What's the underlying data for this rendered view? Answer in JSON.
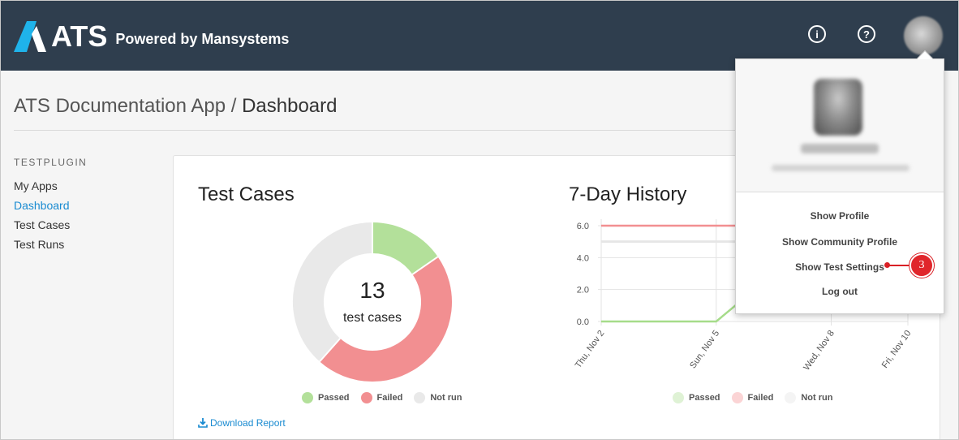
{
  "header": {
    "brand": "ATS",
    "tagline": "Powered by Mansystems",
    "icons": [
      "info-icon",
      "help-icon"
    ],
    "colors": {
      "bar": "#2f3e4e",
      "logo": "#1fb3ea"
    }
  },
  "breadcrumb": {
    "app": "ATS Documentation App",
    "separator": "/",
    "current": "Dashboard"
  },
  "sidebar": {
    "heading": "TESTPLUGIN",
    "items": [
      {
        "label": "My Apps",
        "active": false
      },
      {
        "label": "Dashboard",
        "active": true
      },
      {
        "label": "Test Cases",
        "active": false
      },
      {
        "label": "Test Runs",
        "active": false
      }
    ]
  },
  "test_cases": {
    "title": "Test Cases",
    "count": "13",
    "count_label": "test cases",
    "download_label": "Download Report"
  },
  "history": {
    "title": "7-Day History"
  },
  "legend": {
    "passed": "Passed",
    "failed": "Failed",
    "not_run": "Not run"
  },
  "dropdown": {
    "items": [
      "Show Profile",
      "Show Community Profile",
      "Show Test Settings",
      "Log out"
    ],
    "callout": "3"
  },
  "chart_data": [
    {
      "type": "pie",
      "title": "Test Cases",
      "categories": [
        "Passed",
        "Failed",
        "Not run"
      ],
      "values": [
        2,
        6,
        5
      ],
      "colors": [
        "#b3e09a",
        "#f28f91",
        "#e9e9e9"
      ]
    },
    {
      "type": "line",
      "title": "7-Day History",
      "x": [
        "Thu, Nov 2",
        "Sun, Nov 5",
        "Wed, Nov 8",
        "Fri, Nov 10"
      ],
      "ylim": [
        0,
        6
      ],
      "yticks": [
        "0.0",
        "2.0",
        "4.0",
        "6.0"
      ],
      "series": [
        {
          "name": "Passed",
          "color": "#a6dc8a",
          "points": [
            [
              "Thu, Nov 2",
              0
            ],
            [
              "Sun, Nov 5",
              0
            ],
            [
              "Mon, Nov 6",
              2
            ]
          ]
        },
        {
          "name": "Failed",
          "color": "#f28f91",
          "points": [
            [
              "Thu, Nov 2",
              6
            ],
            [
              "Mon, Nov 6",
              6
            ]
          ]
        },
        {
          "name": "Not run",
          "color": "#e6e6e6",
          "points": [
            [
              "Thu, Nov 2",
              5
            ],
            [
              "Mon, Nov 6",
              5
            ]
          ]
        }
      ],
      "grid": true
    }
  ]
}
